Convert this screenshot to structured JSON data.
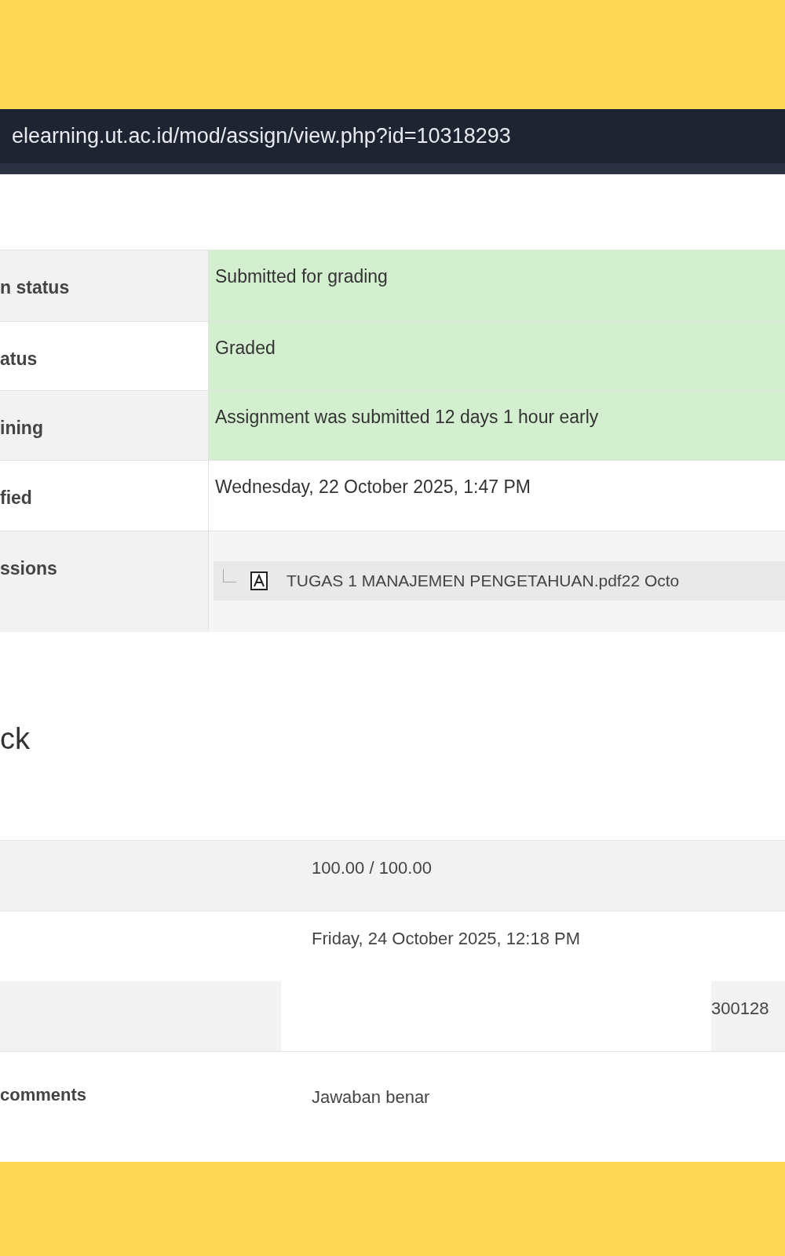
{
  "address_bar": {
    "url": "elearning.ut.ac.id/mod/assign/view.php?id=10318293"
  },
  "submission_status": {
    "rows": [
      {
        "label": "n status",
        "value": "Submitted for grading",
        "highlight": true
      },
      {
        "label": "atus",
        "value": "Graded",
        "highlight": true
      },
      {
        "label": "ining",
        "value": "Assignment was submitted 12 days 1 hour early",
        "highlight": true
      },
      {
        "label": "fied",
        "value": "Wednesday, 22 October 2025, 1:47 PM",
        "highlight": false
      },
      {
        "label": "ssions",
        "kind": "file",
        "file": "TUGAS 1 MANAJEMEN PENGETAHUAN.pdf22 Octo",
        "highlight": false
      }
    ]
  },
  "feedback": {
    "heading": "ck",
    "rows": [
      {
        "kind": "text",
        "value": "100.00 / 100.00"
      },
      {
        "kind": "text",
        "value": "Friday, 24 October 2025, 12:18 PM"
      },
      {
        "kind": "split",
        "value": "300128"
      },
      {
        "kind": "text",
        "label": "comments",
        "value": "Jawaban benar"
      }
    ]
  }
}
